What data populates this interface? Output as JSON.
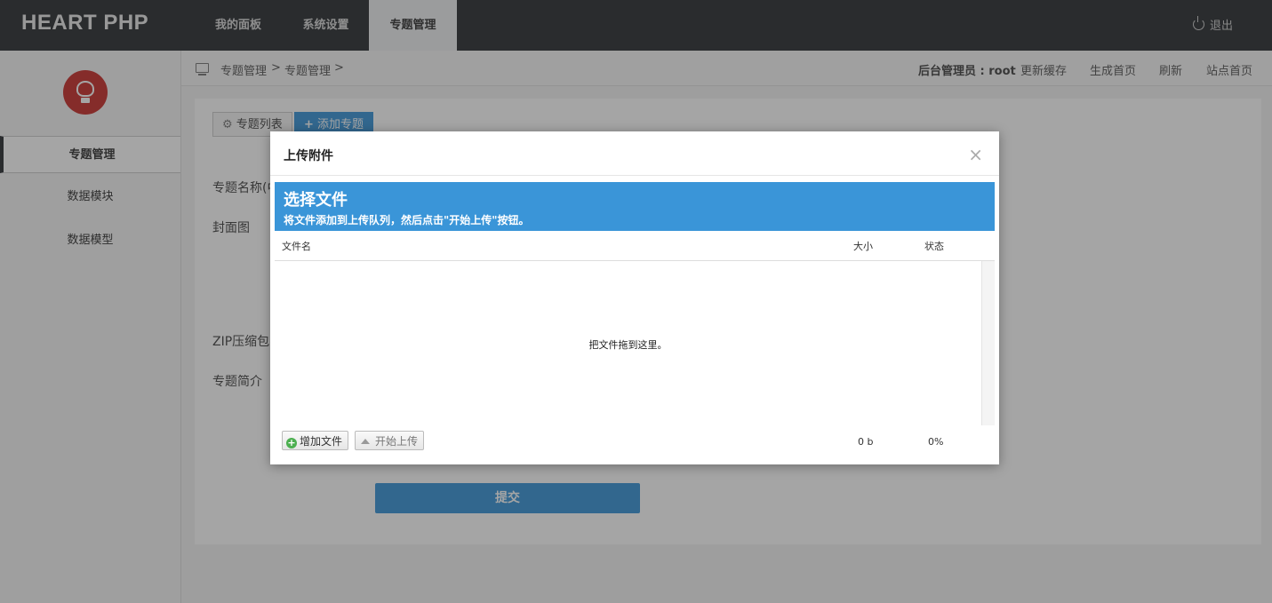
{
  "brand": "HEART PHP",
  "nav": {
    "tabs": [
      {
        "label": "我的面板"
      },
      {
        "label": "系统设置"
      },
      {
        "label": "专题管理"
      }
    ],
    "logout": "退出"
  },
  "sidebar": {
    "items": [
      {
        "label": "专题管理"
      },
      {
        "label": "数据模块"
      },
      {
        "label": "数据模型"
      }
    ]
  },
  "breadcrumb": {
    "items": [
      "专题管理",
      "专题管理"
    ],
    "separator": ">"
  },
  "header_links": {
    "admin": "后台管理员 : root",
    "clear_cache": "更新缓存",
    "gen_home": "生成首页",
    "refresh": "刷新",
    "site_home": "站点首页"
  },
  "panel": {
    "tab_list": "专题列表",
    "tab_add": "添加专题",
    "labels": {
      "name": "专题名称(中",
      "cover": "封面图",
      "zip": "ZIP压缩包",
      "intro": "专题简介"
    },
    "submit": "提交"
  },
  "modal": {
    "title": "上传附件",
    "close": "×",
    "uploader": {
      "heading": "选择文件",
      "subheading": "将文件添加到上传队列，然后点击\"开始上传\"按钮。",
      "columns": {
        "filename": "文件名",
        "size": "大小",
        "status": "状态"
      },
      "drop_text": "把文件拖到这里。",
      "add_button": "增加文件",
      "start_button": "开始上传",
      "total_size": "0 b",
      "total_percent": "0%"
    }
  },
  "colors": {
    "topbar": "#2b2f33",
    "accent": "#3a95d8",
    "logo": "#c9302c"
  }
}
